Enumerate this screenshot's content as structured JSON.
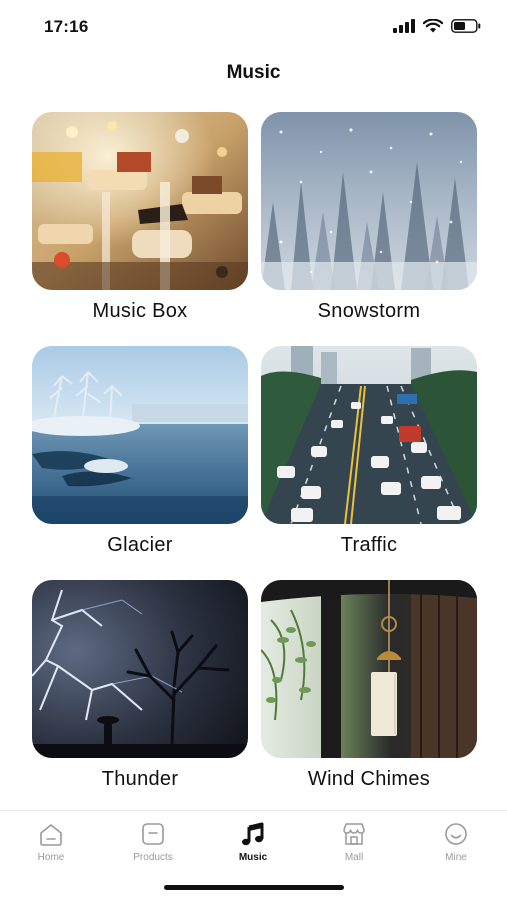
{
  "status_bar": {
    "time": "17:16"
  },
  "header": {
    "title": "Music"
  },
  "sounds": [
    {
      "label": "Music Box",
      "image": "music-box-image"
    },
    {
      "label": "Snowstorm",
      "image": "snowstorm-image"
    },
    {
      "label": "Glacier",
      "image": "glacier-image"
    },
    {
      "label": "Traffic",
      "image": "traffic-image"
    },
    {
      "label": "Thunder",
      "image": "thunder-image"
    },
    {
      "label": "Wind Chimes",
      "image": "wind-chimes-image"
    }
  ],
  "tab_bar": {
    "items": [
      {
        "label": "Home",
        "icon": "home-icon"
      },
      {
        "label": "Products",
        "icon": "products-icon"
      },
      {
        "label": "Music",
        "icon": "music-note-icon",
        "active": true
      },
      {
        "label": "Mall",
        "icon": "mall-icon"
      },
      {
        "label": "Mine",
        "icon": "mine-icon"
      }
    ]
  }
}
